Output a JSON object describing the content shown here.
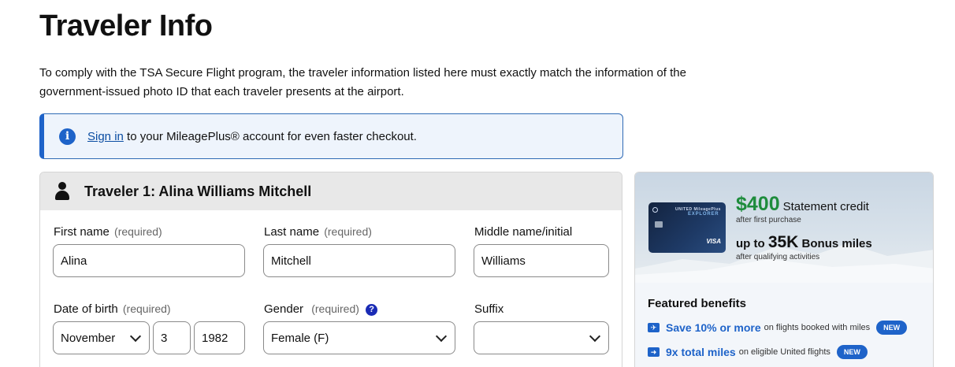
{
  "page": {
    "title": "Traveler Info",
    "intro_line1": "To comply with the TSA Secure Flight program, the traveler information listed here must exactly match the information of the",
    "intro_line2": "government-issued photo ID that each traveler presents at the airport."
  },
  "signin_banner": {
    "icon": "info-icon",
    "link_text": "Sign in",
    "message": "to your MileagePlus® account for even faster checkout."
  },
  "traveler": {
    "icon": "person-icon",
    "heading": "Traveler 1: Alina Williams Mitchell",
    "required_suffix": "(required)",
    "first_name": {
      "label": "First name",
      "value": "Alina"
    },
    "last_name": {
      "label": "Last name",
      "value": "Mitchell"
    },
    "middle_name": {
      "label": "Middle name/initial",
      "value": "Williams"
    },
    "dob": {
      "label": "Date of birth",
      "month": "November",
      "day": "3",
      "year": "1982"
    },
    "gender": {
      "label": "Gender",
      "value": "Female (F)",
      "help_icon": "?"
    },
    "suffix": {
      "label": "Suffix",
      "value": ""
    }
  },
  "promo": {
    "card_brand_top": "UNITED MileagePlus",
    "card_brand_name": "EXPLORER",
    "card_network": "VISA",
    "credit_amount": "$400",
    "credit_text": "Statement credit",
    "credit_sub": "after first purchase",
    "miles_prefix": "up to",
    "miles_amount": "35K",
    "miles_text": "Bonus miles",
    "miles_sub": "after qualifying activities",
    "benefits_title": "Featured benefits",
    "benefits": [
      {
        "strong": "Save 10% or more",
        "text": "on flights booked with miles",
        "badge": "NEW"
      },
      {
        "strong": "9x total miles",
        "text": "on eligible United flights",
        "badge": "NEW"
      }
    ]
  },
  "colors": {
    "accent": "#1e63c9",
    "green": "#1e8c3c",
    "link": "#0b4da2"
  }
}
